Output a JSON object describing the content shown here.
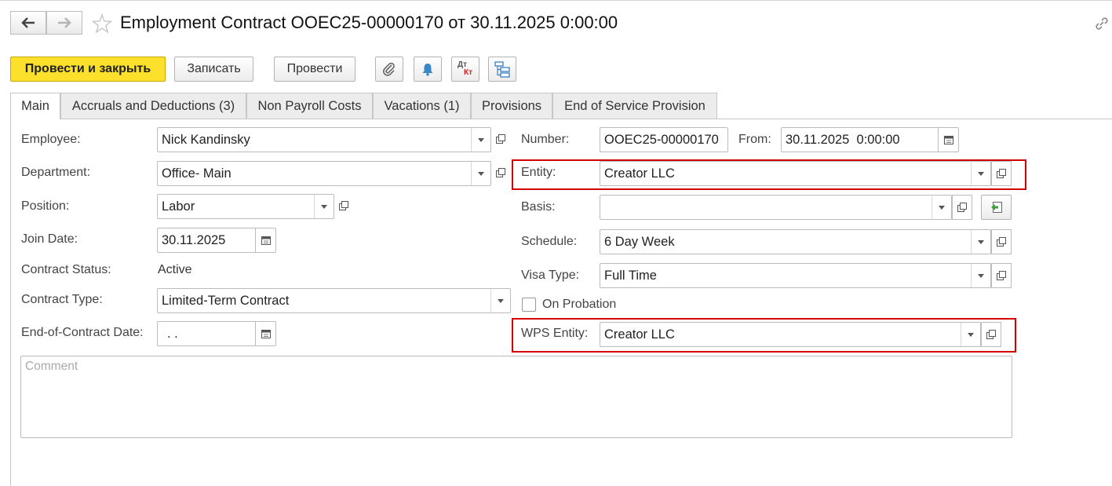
{
  "header": {
    "title": "Employment Contract OOEC25-00000170 от 30.11.2025 0:00:00"
  },
  "toolbar": {
    "post_close_label": "Провести и закрыть",
    "save_label": "Записать",
    "post_label": "Провести",
    "dt_kt_top": "Дт",
    "dt_kt_bottom": "Кт"
  },
  "tabs": [
    {
      "label": "Main"
    },
    {
      "label": "Accruals and Deductions (3)"
    },
    {
      "label": "Non Payroll Costs"
    },
    {
      "label": "Vacations (1)"
    },
    {
      "label": "Provisions"
    },
    {
      "label": "End of Service Provision"
    }
  ],
  "form": {
    "employee": {
      "label": "Employee:",
      "value": "Nick Kandinsky"
    },
    "department": {
      "label": "Department:",
      "value": "Office- Main"
    },
    "position": {
      "label": "Position:",
      "value": "Labor"
    },
    "join_date": {
      "label": "Join Date:",
      "value": "30.11.2025"
    },
    "contract_status": {
      "label": "Contract Status:",
      "value": "Active"
    },
    "contract_type": {
      "label": "Contract Type:",
      "value": "Limited-Term Contract"
    },
    "end_date": {
      "label": "End-of-Contract Date:",
      "value": " .  ."
    },
    "number": {
      "label": "Number:",
      "value": "OOEC25-00000170"
    },
    "from": {
      "label": "From:",
      "value": "30.11.2025  0:00:00"
    },
    "entity": {
      "label": "Entity:",
      "value": "Creator LLC"
    },
    "basis": {
      "label": "Basis:",
      "value": ""
    },
    "schedule": {
      "label": "Schedule:",
      "value": "6 Day Week"
    },
    "visa_type": {
      "label": "Visa Type:",
      "value": "Full Time"
    },
    "on_probation": {
      "label": "On Probation",
      "checked": false
    },
    "wps_entity": {
      "label": "WPS Entity:",
      "value": "Creator LLC"
    },
    "comment": {
      "placeholder": "Comment",
      "value": ""
    }
  },
  "colors": {
    "primary_button": "#fbe02c",
    "highlight_box": "#d40000"
  }
}
